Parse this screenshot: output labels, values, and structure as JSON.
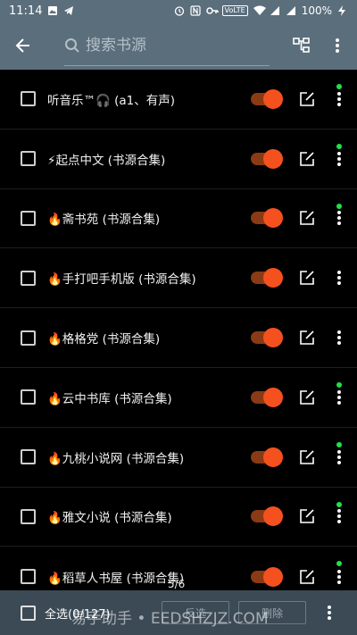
{
  "status_bar": {
    "time": "11:14",
    "volte": "VoLTE",
    "battery": "100%"
  },
  "toolbar": {
    "search_placeholder": "搜索书源"
  },
  "rows": [
    {
      "label": "听音乐™🎧 (a1、有声)",
      "enabled": true,
      "has_dot": true
    },
    {
      "label": "⚡起点中文 (书源合集)",
      "enabled": true,
      "has_dot": true
    },
    {
      "label": "🔥斋书苑 (书源合集)",
      "enabled": true,
      "has_dot": true
    },
    {
      "label": "🔥手打吧手机版 (书源合集)",
      "enabled": true,
      "has_dot": false
    },
    {
      "label": "🔥格格党 (书源合集)",
      "enabled": true,
      "has_dot": false
    },
    {
      "label": "🔥云中书库 (书源合集)",
      "enabled": true,
      "has_dot": true
    },
    {
      "label": "🔥九桃小说网 (书源合集)",
      "enabled": true,
      "has_dot": true
    },
    {
      "label": "🔥雅文小说 (书源合集)",
      "enabled": true,
      "has_dot": true
    },
    {
      "label": "🔥稻草人书屋 (书源合集)",
      "enabled": true,
      "has_dot": true
    }
  ],
  "bottom_bar": {
    "select_all_label": "全选(0/127)",
    "reverse_label": "反选",
    "delete_label": "删除"
  },
  "page_indicator": "5/6",
  "watermark": "易手助手 • EEDSHZJZ.COM",
  "colors": {
    "toolbar": "#5b6e7c",
    "toggle_knob": "#f4511e",
    "dot": "#22e046",
    "bottom_bar": "#3c4a55"
  }
}
